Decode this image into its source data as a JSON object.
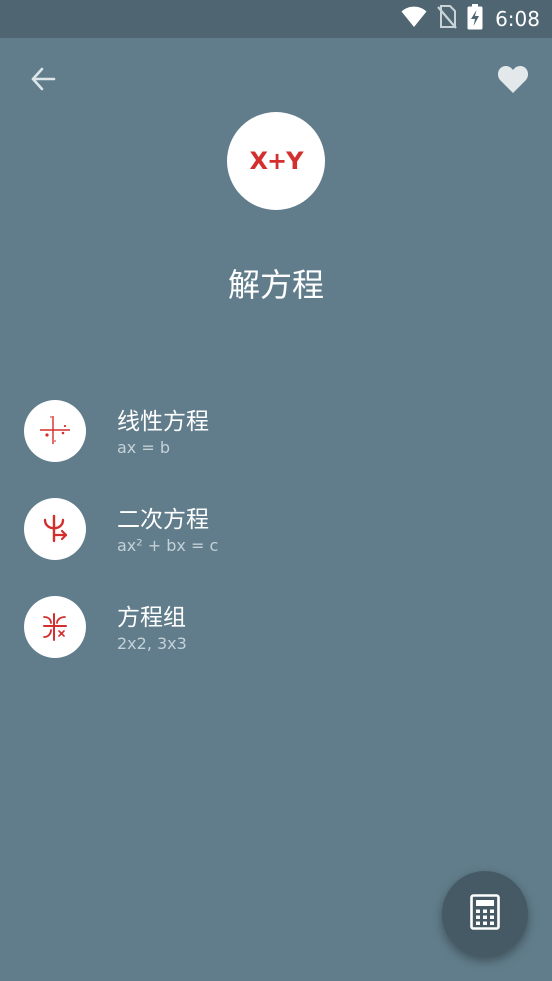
{
  "status_bar": {
    "time": "6:08",
    "icons": [
      "wifi-icon",
      "no-sim-icon",
      "battery-charging-icon"
    ]
  },
  "header": {
    "back_icon": "arrow-back-icon",
    "favorite_icon": "heart-icon",
    "logo_text": "X+Y",
    "title": "解方程"
  },
  "items": [
    {
      "title": "线性方程",
      "subtitle": "ax = b",
      "icon": "linear-graph-icon"
    },
    {
      "title": "二次方程",
      "subtitle": "ax² + bx = c",
      "icon": "quadratic-icon"
    },
    {
      "title": "方程组",
      "subtitle": "2x2, 3x3",
      "icon": "system-equations-icon"
    }
  ],
  "fab": {
    "icon": "calculator-icon"
  },
  "colors": {
    "background": "#617d8b",
    "status_bar": "#4f6672",
    "accent": "#d32f2f",
    "fab": "#455a64"
  }
}
